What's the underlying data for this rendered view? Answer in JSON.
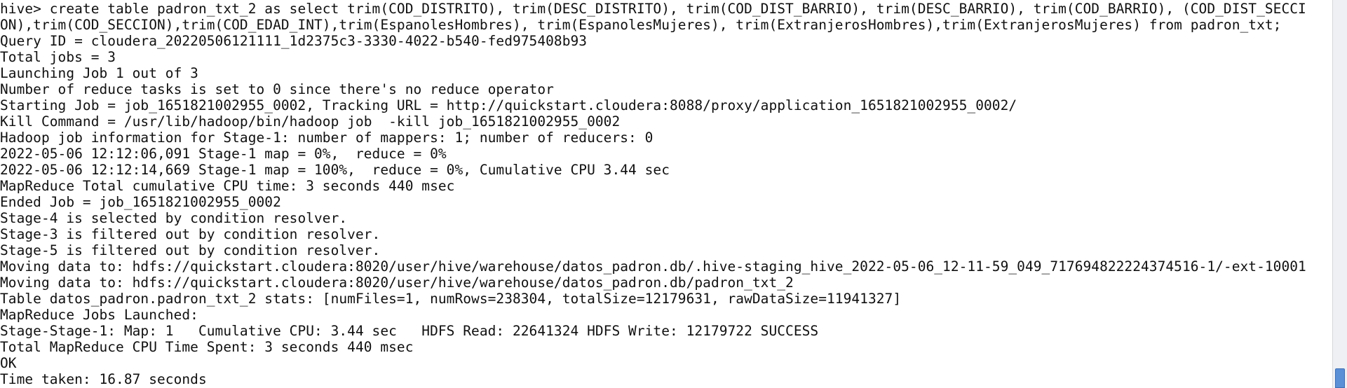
{
  "terminal": {
    "lines": [
      "hive> create table padron_txt_2 as select trim(COD_DISTRITO), trim(DESC_DISTRITO), trim(COD_DIST_BARRIO), trim(DESC_BARRIO), trim(COD_BARRIO), (COD_DIST_SECCI",
      "ON),trim(COD_SECCION),trim(COD_EDAD_INT),trim(EspanolesHombres), trim(EspanolesMujeres), trim(ExtranjerosHombres),trim(ExtranjerosMujeres) from padron_txt;",
      "Query ID = cloudera_20220506121111_1d2375c3-3330-4022-b540-fed975408b93",
      "Total jobs = 3",
      "Launching Job 1 out of 3",
      "Number of reduce tasks is set to 0 since there's no reduce operator",
      "Starting Job = job_1651821002955_0002, Tracking URL = http://quickstart.cloudera:8088/proxy/application_1651821002955_0002/",
      "Kill Command = /usr/lib/hadoop/bin/hadoop job  -kill job_1651821002955_0002",
      "Hadoop job information for Stage-1: number of mappers: 1; number of reducers: 0",
      "2022-05-06 12:12:06,091 Stage-1 map = 0%,  reduce = 0%",
      "2022-05-06 12:12:14,669 Stage-1 map = 100%,  reduce = 0%, Cumulative CPU 3.44 sec",
      "MapReduce Total cumulative CPU time: 3 seconds 440 msec",
      "Ended Job = job_1651821002955_0002",
      "Stage-4 is selected by condition resolver.",
      "Stage-3 is filtered out by condition resolver.",
      "Stage-5 is filtered out by condition resolver.",
      "Moving data to: hdfs://quickstart.cloudera:8020/user/hive/warehouse/datos_padron.db/.hive-staging_hive_2022-05-06_12-11-59_049_717694822224374516-1/-ext-10001",
      "Moving data to: hdfs://quickstart.cloudera:8020/user/hive/warehouse/datos_padron.db/padron_txt_2",
      "Table datos_padron.padron_txt_2 stats: [numFiles=1, numRows=238304, totalSize=12179631, rawDataSize=11941327]",
      "MapReduce Jobs Launched:",
      "Stage-Stage-1: Map: 1   Cumulative CPU: 3.44 sec   HDFS Read: 22641324 HDFS Write: 12179722 SUCCESS",
      "Total MapReduce CPU Time Spent: 3 seconds 440 msec",
      "OK",
      "Time taken: 16.87 seconds"
    ]
  },
  "colors": {
    "background": "#ffffff",
    "text": "#101010",
    "scroll_thumb": "#5b8fd6"
  }
}
